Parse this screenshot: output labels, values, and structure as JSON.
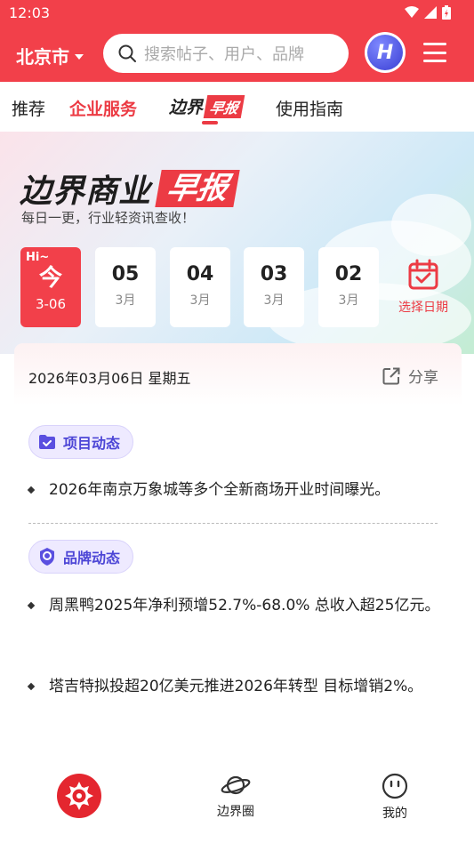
{
  "status_bar": {
    "time": "12:03"
  },
  "header": {
    "city": "北京市",
    "search_placeholder": "搜索帖子、用户、品牌",
    "avatar_letter": "H"
  },
  "tabs": [
    {
      "label": "推荐"
    },
    {
      "label": "企业服务"
    },
    {
      "label_main": "边界",
      "label_badge": "早报"
    },
    {
      "label": "使用指南"
    }
  ],
  "banner": {
    "title_main": "边界商业",
    "title_badge": "早报",
    "subtitle": "每日一更，行业轻资讯查收！",
    "today": {
      "hi": "Hi~",
      "label": "今",
      "date": "3-06"
    },
    "dates": [
      {
        "day": "05",
        "month": "3月"
      },
      {
        "day": "04",
        "month": "3月"
      },
      {
        "day": "03",
        "month": "3月"
      },
      {
        "day": "02",
        "month": "3月"
      }
    ],
    "pick_date_label": "选择日期"
  },
  "card": {
    "date": "2026年03月06日 星期五",
    "share_label": "分享",
    "sections": [
      {
        "title": "项目动态",
        "items": [
          "2026年南京万象城等多个全新商场开业时间曝光。"
        ]
      },
      {
        "title": "品牌动态",
        "items": [
          "周黑鸭2025年净利预增52.7%-68.0% 总收入超25亿元。",
          "塔吉特拟投超20亿美元推进2026年转型 目标增销2%。"
        ]
      }
    ]
  },
  "bottom_nav": {
    "items": [
      {
        "label": "边界圈"
      },
      {
        "label": "我的"
      }
    ]
  },
  "colors": {
    "brand_red": "#f2404a",
    "chip_purple": "#4d46d6"
  }
}
